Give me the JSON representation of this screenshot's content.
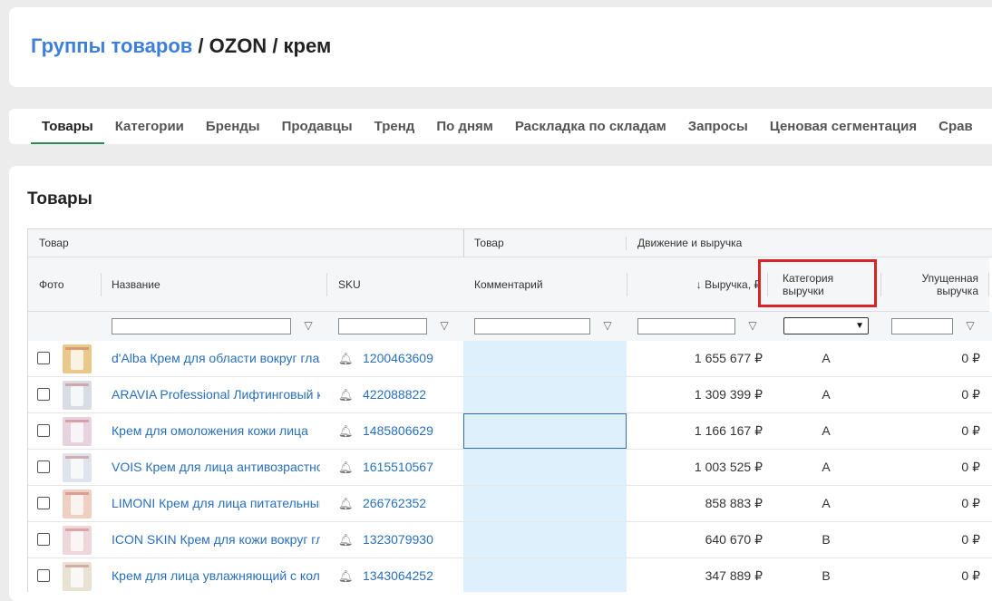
{
  "breadcrumb": {
    "link": "Группы товаров",
    "sep1": " / ",
    "part2": "OZON",
    "sep2": " / ",
    "part3": "крем"
  },
  "tabs": [
    {
      "label": "Товары",
      "active": true
    },
    {
      "label": "Категории"
    },
    {
      "label": "Бренды"
    },
    {
      "label": "Продавцы"
    },
    {
      "label": "Тренд"
    },
    {
      "label": "По дням"
    },
    {
      "label": "Раскладка по складам"
    },
    {
      "label": "Запросы"
    },
    {
      "label": "Ценовая сегментация"
    },
    {
      "label": "Срав"
    }
  ],
  "section": {
    "title": "Товары"
  },
  "table": {
    "groups": {
      "product": "Товар",
      "product2": "Товар",
      "movement": "Движение и выручка"
    },
    "columns": {
      "photo": "Фото",
      "name": "Название",
      "sku": "SKU",
      "comment": "Комментарий",
      "revenue": "↓ Выручка, ₽",
      "category_l1": "Категория",
      "category_l2": "выручки",
      "lost_l1": "Упущенная",
      "lost_l2": "выручка"
    },
    "filter_icon": "filter-icon",
    "rows": [
      {
        "name": "d'Alba Крем для области вокруг глаз",
        "sku": "1200463609",
        "revenue": "1 655 677 ₽",
        "category": "A",
        "lost": "0 ₽",
        "thumb": "#e9c98b"
      },
      {
        "name": "ARAVIA Professional Лифтинговый крем",
        "sku": "422088822",
        "revenue": "1 309 399 ₽",
        "category": "A",
        "lost": "0 ₽",
        "thumb": "#d9dde3"
      },
      {
        "name": "Крем для омоложения кожи лица",
        "sku": "1485806629",
        "revenue": "1 166 167 ₽",
        "category": "A",
        "lost": "0 ₽",
        "thumb": "#e7d3dd"
      },
      {
        "name": "VOIS Крем для лица антивозрастной",
        "sku": "1615510567",
        "revenue": "1 003 525 ₽",
        "category": "A",
        "lost": "0 ₽",
        "thumb": "#dfe4ec"
      },
      {
        "name": "LIMONI Крем для лица питательный",
        "sku": "266762352",
        "revenue": "858 883 ₽",
        "category": "A",
        "lost": "0 ₽",
        "thumb": "#efcfc2"
      },
      {
        "name": "ICON SKIN Крем для кожи вокруг глаз",
        "sku": "1323079930",
        "revenue": "640 670 ₽",
        "category": "B",
        "lost": "0 ₽",
        "thumb": "#eed7da"
      },
      {
        "name": "Крем для лица увлажняющий с коллагеном",
        "sku": "1343064252",
        "revenue": "347 889 ₽",
        "category": "B",
        "lost": "0 ₽",
        "thumb": "#e8e2d5"
      }
    ]
  },
  "colors": {
    "link": "#3d7fd9",
    "active_tab_underline": "#2e8b57",
    "highlight_box": "#d9232a",
    "comment_bg": "#ddf0fb"
  }
}
